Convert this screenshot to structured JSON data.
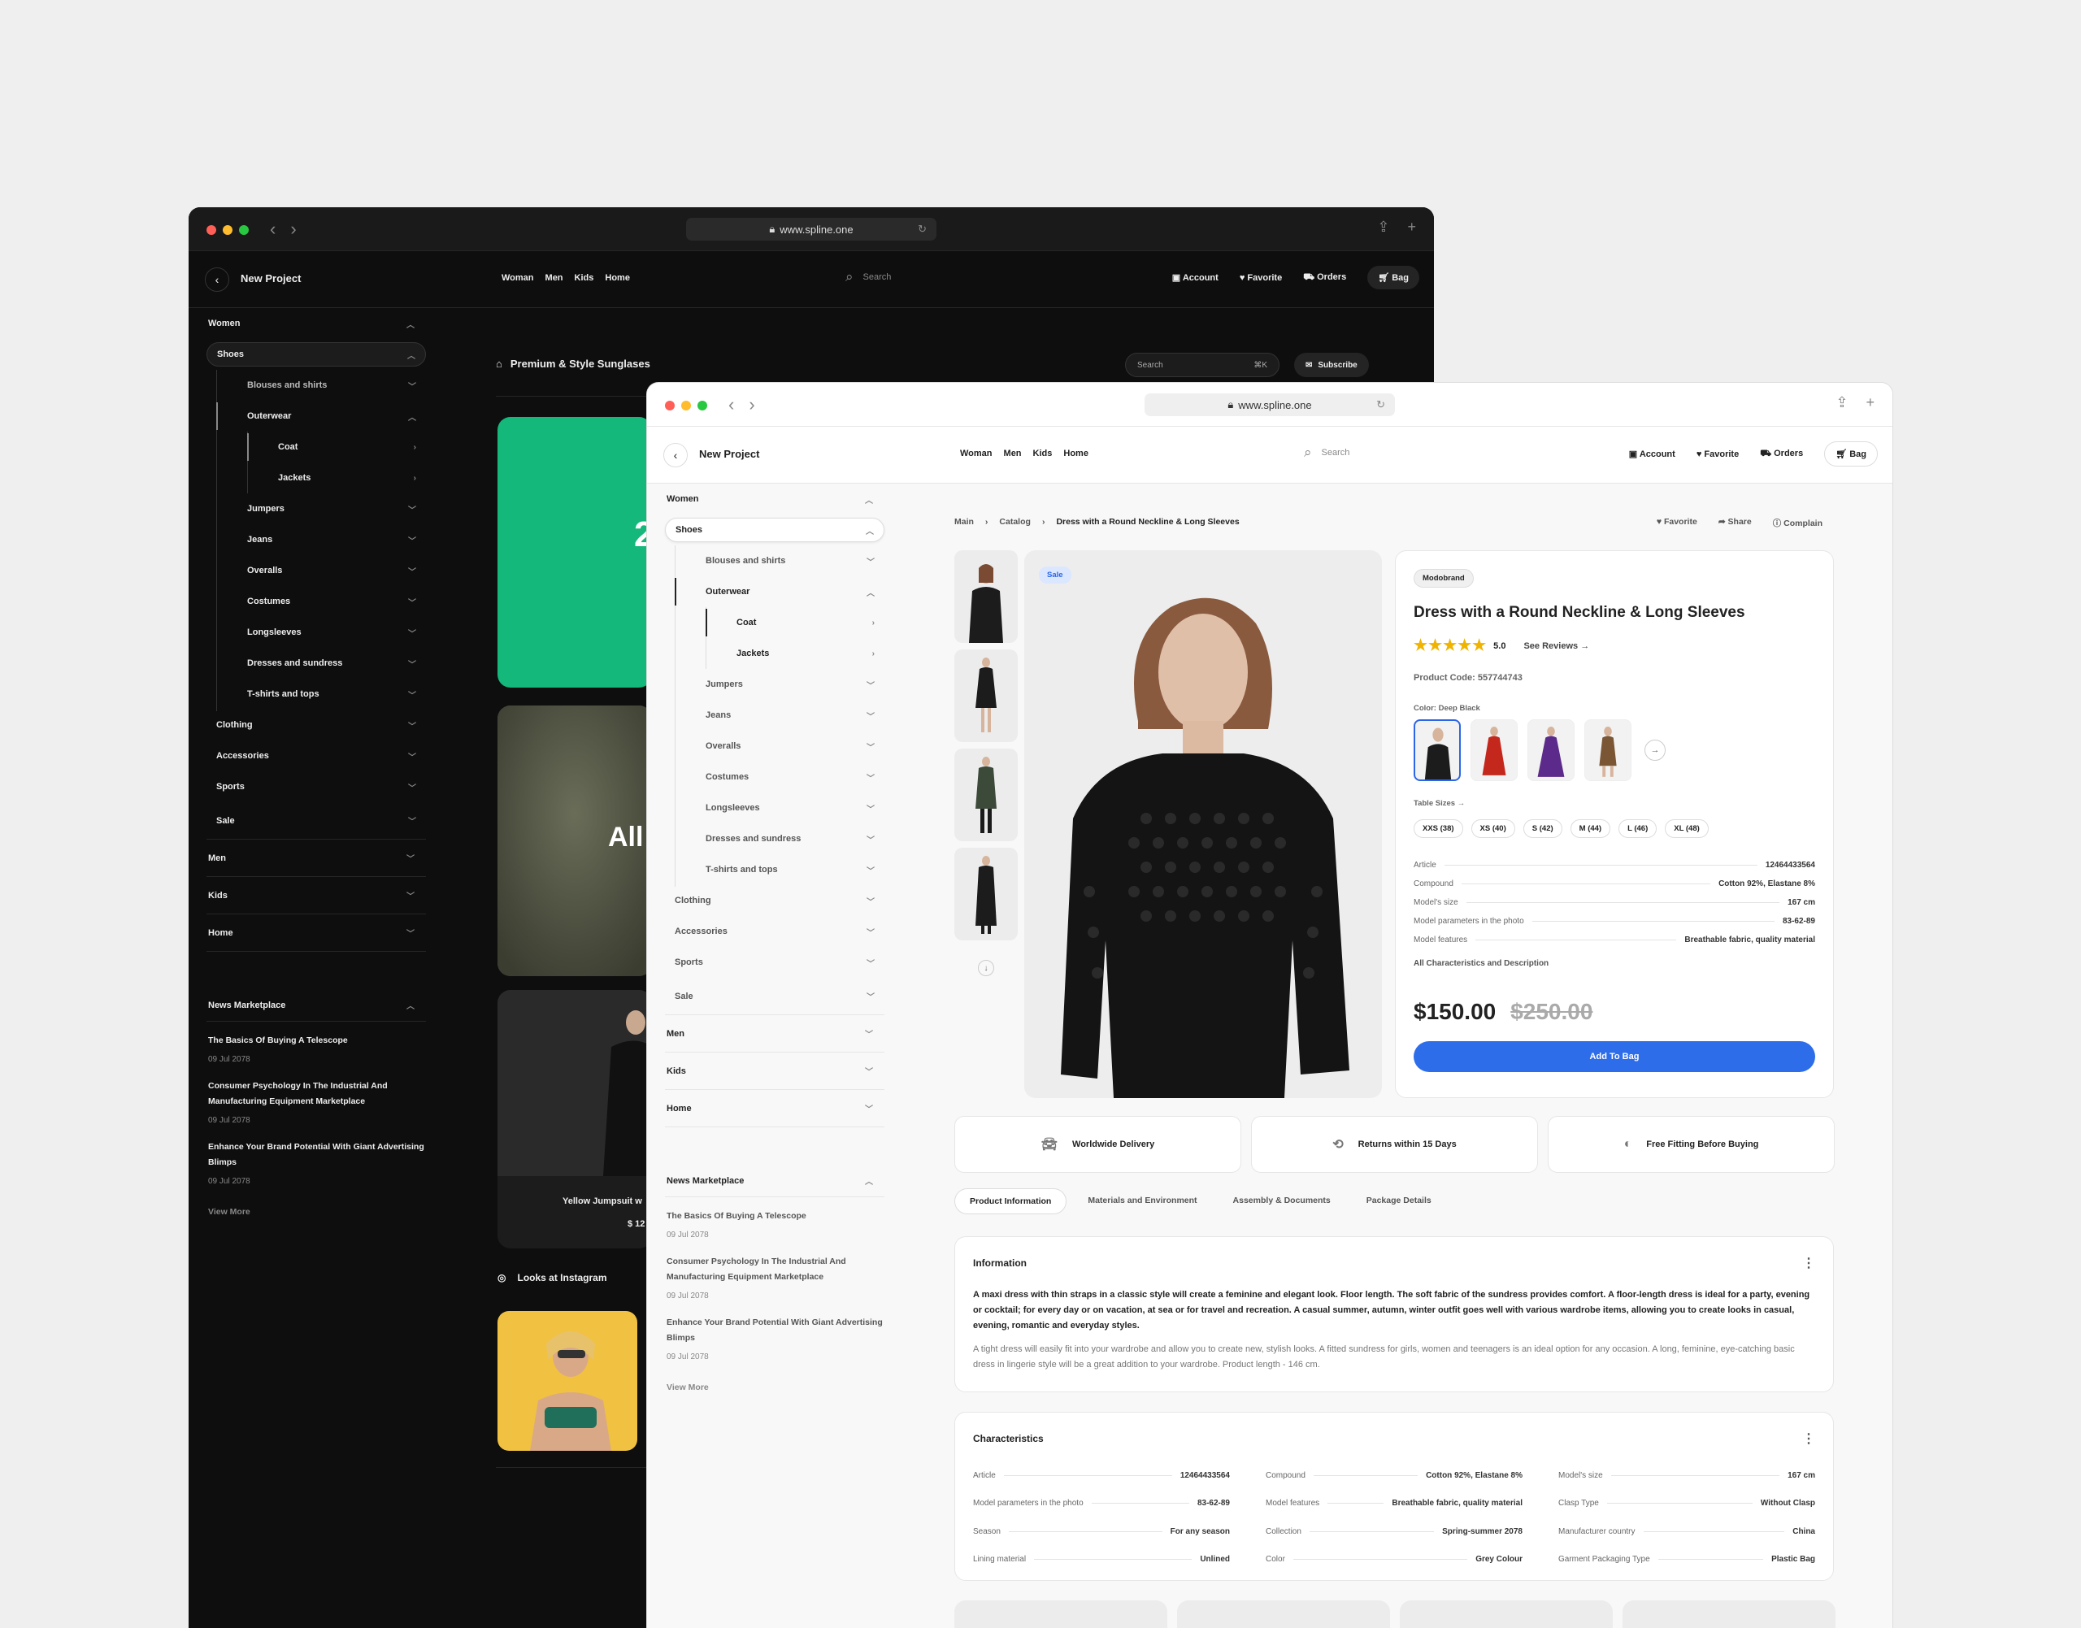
{
  "dark_window": {
    "url": "www.spline.one",
    "project": "New Project",
    "nav": [
      "Woman",
      "Men",
      "Kids",
      "Home"
    ],
    "search_placeholder": "Search",
    "account": "Account",
    "favorite": "Favorite",
    "orders": "Orders",
    "bag": "Bag",
    "section_title": "Premium & Style Sunglases",
    "search_small": "Search",
    "search_shortcut": "⌘K",
    "subscribe": "Subscribe",
    "green_card_text": "2",
    "olive_card_text": "All",
    "product_name": "Yellow Jumpsuit w",
    "product_price": "$ 12",
    "instagram": "Looks at Instagram"
  },
  "light_window": {
    "url": "www.spline.one",
    "project": "New Project",
    "nav": [
      "Woman",
      "Men",
      "Kids",
      "Home"
    ],
    "search_placeholder": "Search",
    "account": "Account",
    "favorite": "Favorite",
    "orders": "Orders",
    "bag": "Bag"
  },
  "sidebar": {
    "women": "Women",
    "shoes": "Shoes",
    "blouses": "Blouses and shirts",
    "outerwear": "Outerwear",
    "coat": "Coat",
    "jackets": "Jackets",
    "jumpers": "Jumpers",
    "jeans": "Jeans",
    "overalls": "Overalls",
    "costumes": "Costumes",
    "longsleeves": "Longsleeves",
    "dresses": "Dresses and sundress",
    "tshirts": "T-shirts and tops",
    "clothing": "Clothing",
    "accessories": "Accessories",
    "sports": "Sports",
    "sale": "Sale",
    "men": "Men",
    "kids": "Kids",
    "home": "Home"
  },
  "news": {
    "title": "News Marketplace",
    "items": [
      {
        "title": "The Basics Of Buying A Telescope",
        "date": "09 Jul 2078"
      },
      {
        "title": "Consumer Psychology In The Industrial And Manufacturing Equipment Marketplace",
        "date": "09 Jul 2078"
      },
      {
        "title": "Enhance Your Brand Potential With Giant Advertising Blimps",
        "date": "09 Jul 2078"
      }
    ],
    "view_more": "View More"
  },
  "breadcrumb": [
    "Main",
    "Catalog",
    "Dress with a Round Neckline & Long Sleeves"
  ],
  "crumb_actions": {
    "favorite": "Favorite",
    "share": "Share",
    "complain": "Complain"
  },
  "product": {
    "sale_badge": "Sale",
    "brand": "Modobrand",
    "title": "Dress with a Round Neckline & Long Sleeves",
    "rating": "5.0",
    "stars": "★★★★★",
    "see_reviews": "See Reviews",
    "code": "Product Code: 557744743",
    "color_label": "Color: Deep Black",
    "table_sizes": "Table Sizes",
    "sizes": [
      "XXS (38)",
      "XS (40)",
      "S (42)",
      "M (44)",
      "L (46)",
      "XL (48)"
    ],
    "specs": [
      {
        "k": "Article",
        "v": "12464433564"
      },
      {
        "k": "Compound",
        "v": "Cotton 92%, Elastane 8%"
      },
      {
        "k": "Model's size",
        "v": "167 cm"
      },
      {
        "k": "Model parameters in the photo",
        "v": "83-62-89"
      },
      {
        "k": "Model features",
        "v": "Breathable fabric, quality material"
      }
    ],
    "all_characteristics": "All Characteristics and Description",
    "price": "$150.00",
    "old_price": "$250.00",
    "add_to_bag": "Add To Bag"
  },
  "features": [
    "Worldwide Delivery",
    "Returns within 15 Days",
    "Free Fitting Before Buying"
  ],
  "tabs": [
    "Product Information",
    "Materials and Environment",
    "Assembly & Documents",
    "Package Details"
  ],
  "information": {
    "title": "Information",
    "p1": "A maxi dress with thin straps in a classic style will create a feminine and elegant look. Floor length. The soft fabric of the sundress provides comfort. A floor-length dress is ideal for a party, evening or cocktail; for every day or on vacation, at sea or for travel and recreation. A casual summer, autumn, winter outfit goes well with various wardrobe items, allowing you to create looks in casual, evening, romantic and everyday styles.",
    "p2": "A tight dress will easily fit into your wardrobe and allow you to create new, stylish looks. A fitted sundress for girls, women and teenagers is an ideal option for any occasion. A long, feminine, eye-catching basic dress in lingerie style will be a great addition to your wardrobe. Product length - 146 cm."
  },
  "characteristics": {
    "title": "Characteristics",
    "items": [
      {
        "k": "Article",
        "v": "12464433564"
      },
      {
        "k": "Compound",
        "v": "Cotton 92%, Elastane 8%"
      },
      {
        "k": "Model's size",
        "v": "167 cm"
      },
      {
        "k": "Model parameters in the photo",
        "v": "83-62-89"
      },
      {
        "k": "Model features",
        "v": "Breathable fabric, quality material"
      },
      {
        "k": "Clasp Type",
        "v": "Without Clasp"
      },
      {
        "k": "Season",
        "v": "For any season"
      },
      {
        "k": "Collection",
        "v": "Spring-summer 2078"
      },
      {
        "k": "Manufacturer country",
        "v": "China"
      },
      {
        "k": "Lining material",
        "v": "Unlined"
      },
      {
        "k": "Color",
        "v": "Grey Colour"
      },
      {
        "k": "Garment Packaging Type",
        "v": "Plastic Bag"
      }
    ]
  },
  "colors": {
    "accent": "#2e6de9",
    "green": "#14b87a",
    "star": "#f0b400"
  }
}
